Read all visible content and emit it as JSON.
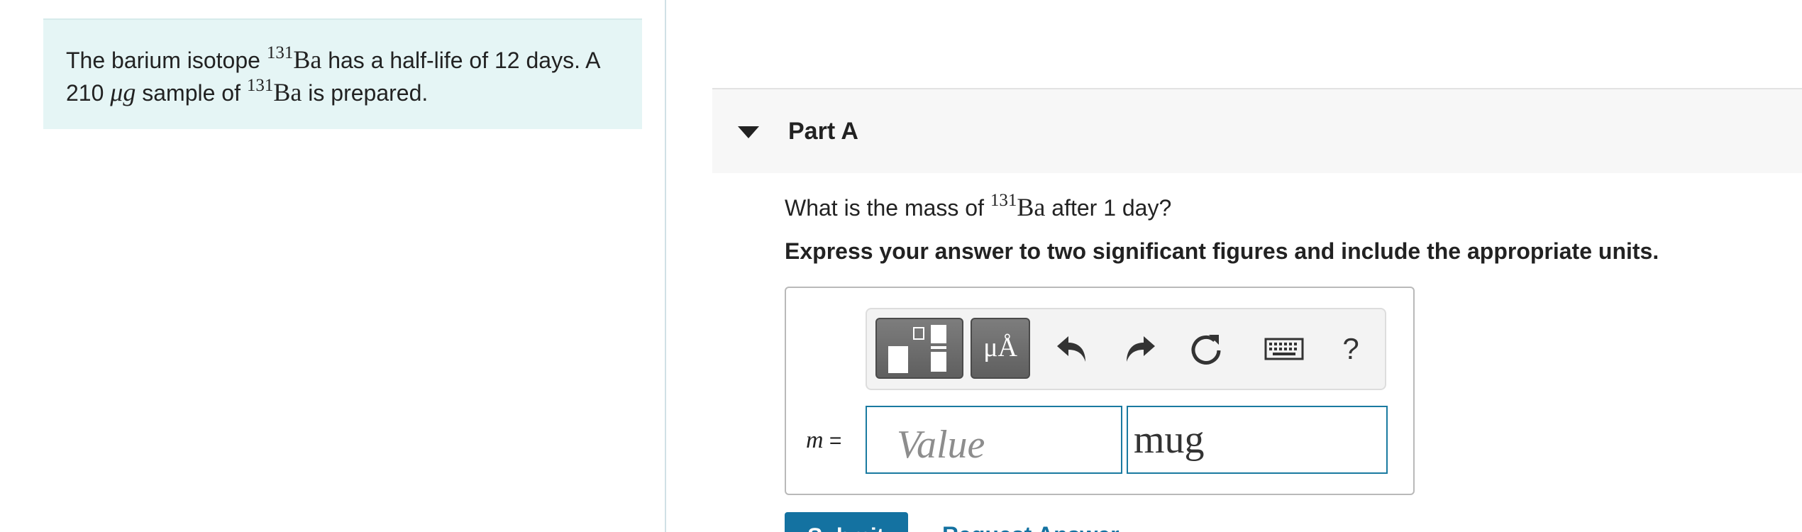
{
  "intro": {
    "text_1": "The barium isotope ",
    "isotope_mass": "131",
    "element": "Ba",
    "text_2": " has a half-life of 12 days. A",
    "text_3": "210 ",
    "unit_micro": "μg",
    "text_4": " sample of ",
    "text_5": " is prepared."
  },
  "part": {
    "title": "Part A",
    "question_1": "What is the mass of ",
    "question_2": " after 1 day?",
    "instruction": "Express your answer to two significant figures and include the appropriate units."
  },
  "toolbar": {
    "units_label": "μÅ",
    "help_label": "?",
    "icons": [
      "templates-icon",
      "units-icon",
      "undo-icon",
      "redo-icon",
      "reset-icon",
      "keyboard-icon",
      "help-icon"
    ]
  },
  "answer": {
    "variable": "m",
    "equals": " =",
    "value_placeholder": "Value",
    "units_value": "mug"
  },
  "actions": {
    "submit_label": "Submit",
    "request_label": "Request Answer"
  },
  "colors": {
    "intro_bg": "#e5f5f5",
    "accent": "#1472a1",
    "input_border": "#1a7aa0"
  }
}
